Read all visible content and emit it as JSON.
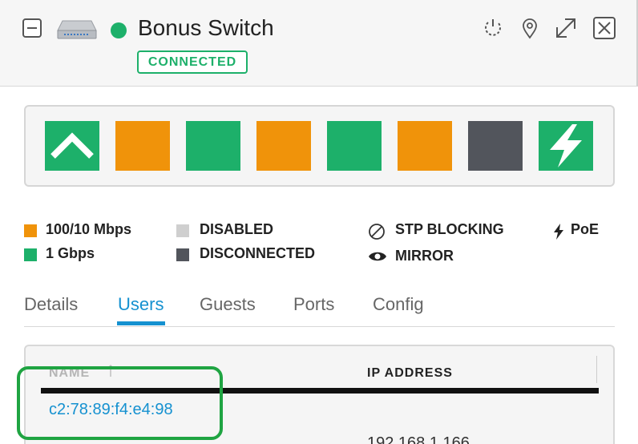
{
  "header": {
    "device_name": "Bonus Switch",
    "status_badge": "CONNECTED",
    "status_color": "#1db06a",
    "icons": [
      "collapse-icon",
      "switch-device-icon",
      "power-restart-icon",
      "locate-pin-icon",
      "expand-icon",
      "close-icon"
    ]
  },
  "ports": [
    {
      "state": "uplink",
      "color": "#1db06a"
    },
    {
      "state": "100/10 Mbps",
      "color": "#f0930a"
    },
    {
      "state": "1 Gbps",
      "color": "#1db06a"
    },
    {
      "state": "100/10 Mbps",
      "color": "#f0930a"
    },
    {
      "state": "1 Gbps",
      "color": "#1db06a"
    },
    {
      "state": "100/10 Mbps",
      "color": "#f0930a"
    },
    {
      "state": "disconnected",
      "color": "#52555c"
    },
    {
      "state": "poe",
      "color": "#1db06a"
    }
  ],
  "legend": {
    "speed_100": "100/10 Mbps",
    "speed_1g": "1 Gbps",
    "disabled": "DISABLED",
    "disconnected": "DISCONNECTED",
    "stp": "STP BLOCKING",
    "mirror": "MIRROR",
    "poe": "PoE"
  },
  "tabs": [
    {
      "label": "Details"
    },
    {
      "label": "Users"
    },
    {
      "label": "Guests"
    },
    {
      "label": "Ports"
    },
    {
      "label": "Config"
    }
  ],
  "active_tab": "Users",
  "table": {
    "columns": [
      "NAME",
      "IP ADDRESS"
    ],
    "rows": [
      {
        "name": "c2:78:89:f4:e4:98",
        "ip": ""
      },
      {
        "name": "",
        "ip": "192.168.1.166"
      }
    ]
  }
}
